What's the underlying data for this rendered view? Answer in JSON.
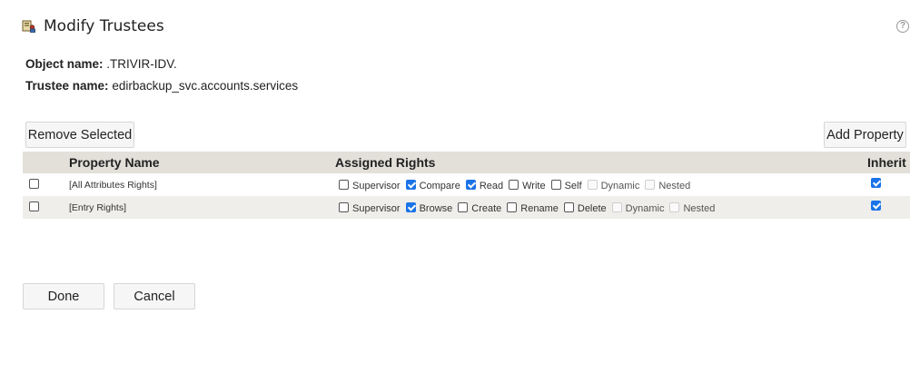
{
  "header": {
    "title": "Modify Trustees",
    "help_icon": "?"
  },
  "info": {
    "object_label": "Object name:",
    "object_value": ".TRIVIR-IDV.",
    "trustee_label": "Trustee name:",
    "trustee_value": "edirbackup_svc.accounts.services"
  },
  "toolbar": {
    "remove_selected": "Remove Selected",
    "add_property": "Add Property"
  },
  "table": {
    "columns": {
      "property_name": "Property Name",
      "assigned_rights": "Assigned Rights",
      "inherit": "Inherit"
    },
    "rows": [
      {
        "property": "[All Attributes Rights]",
        "selected": false,
        "inherit": true,
        "rights": [
          {
            "label": "Supervisor",
            "checked": false,
            "enabled": true
          },
          {
            "label": "Compare",
            "checked": true,
            "enabled": true
          },
          {
            "label": "Read",
            "checked": true,
            "enabled": true
          },
          {
            "label": "Write",
            "checked": false,
            "enabled": true
          },
          {
            "label": "Self",
            "checked": false,
            "enabled": true
          },
          {
            "label": "Dynamic",
            "checked": false,
            "enabled": false
          },
          {
            "label": "Nested",
            "checked": false,
            "enabled": false
          }
        ]
      },
      {
        "property": "[Entry Rights]",
        "selected": false,
        "inherit": true,
        "rights": [
          {
            "label": "Supervisor",
            "checked": false,
            "enabled": true
          },
          {
            "label": "Browse",
            "checked": true,
            "enabled": true
          },
          {
            "label": "Create",
            "checked": false,
            "enabled": true
          },
          {
            "label": "Rename",
            "checked": false,
            "enabled": true
          },
          {
            "label": "Delete",
            "checked": false,
            "enabled": true
          },
          {
            "label": "Dynamic",
            "checked": false,
            "enabled": false
          },
          {
            "label": "Nested",
            "checked": false,
            "enabled": false
          }
        ]
      }
    ]
  },
  "footer": {
    "done": "Done",
    "cancel": "Cancel"
  },
  "colors": {
    "header_bg": "#e3e0da",
    "alt_row_bg": "#efeeeb",
    "checkbox_checked": "#1a73e8"
  }
}
